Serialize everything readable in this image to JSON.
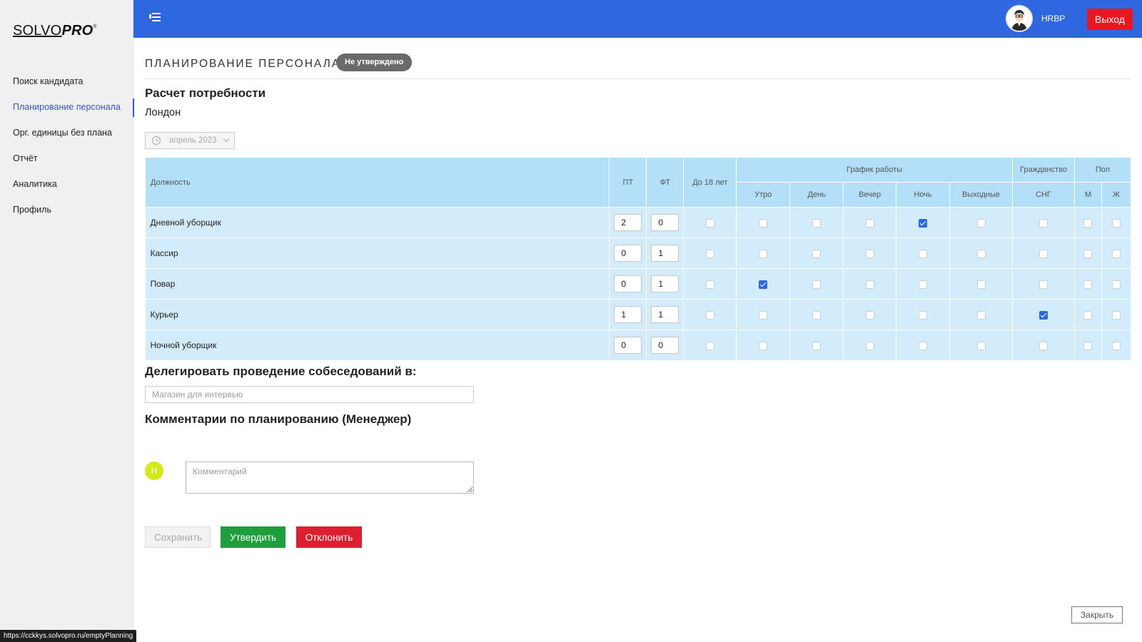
{
  "brand": {
    "solvo": "SOLVO",
    "pro": "PRO",
    "mark": "®"
  },
  "sidebar": {
    "items": [
      {
        "label": "Поиск кандидата",
        "active": false
      },
      {
        "label": "Планирование персонала",
        "active": true
      },
      {
        "label": "Орг. единицы без плана",
        "active": false
      },
      {
        "label": "Отчёт",
        "active": false
      },
      {
        "label": "Аналитика",
        "active": false
      },
      {
        "label": "Профиль",
        "active": false
      }
    ]
  },
  "topbar": {
    "user": "HRBP",
    "logout": "Выход"
  },
  "page": {
    "title": "ПЛАНИРОВАНИЕ ПЕРСОНАЛА",
    "status": "Не утверждено"
  },
  "calc": {
    "title": "Расчет потребности",
    "city": "Лондон",
    "date": "апрель 2023"
  },
  "table": {
    "headers": {
      "position": "Должность",
      "pt": "ПТ",
      "ft": "ФТ",
      "under18": "До 18 лет",
      "schedule": "График работы",
      "citizenship": "Гражданство",
      "gender": "Пол",
      "morning": "Утро",
      "day": "День",
      "evening": "Вечер",
      "night": "Ночь",
      "weekend": "Выходные",
      "cis": "СНГ",
      "male": "М",
      "female": "Ж"
    },
    "rows": [
      {
        "position": "Дневной уборщик",
        "pt": "2",
        "ft": "0",
        "checks": [
          false,
          false,
          false,
          false,
          true,
          false,
          false,
          false,
          false
        ]
      },
      {
        "position": "Кассир",
        "pt": "0",
        "ft": "1",
        "checks": [
          false,
          false,
          false,
          false,
          false,
          false,
          false,
          false,
          false
        ]
      },
      {
        "position": "Повар",
        "pt": "0",
        "ft": "1",
        "checks": [
          false,
          true,
          false,
          false,
          false,
          false,
          false,
          false,
          false
        ]
      },
      {
        "position": "Курьер",
        "pt": "1",
        "ft": "1",
        "checks": [
          false,
          false,
          false,
          false,
          false,
          false,
          true,
          false,
          false
        ]
      },
      {
        "position": "Ночной уборщик",
        "pt": "0",
        "ft": "0",
        "checks": [
          false,
          false,
          false,
          false,
          false,
          false,
          false,
          false,
          false
        ]
      }
    ]
  },
  "delegate": {
    "title": "Делегировать проведение собеседований в:",
    "placeholder": "Магазин для интервью"
  },
  "comments": {
    "title": "Комментарии по планированию (Менеджер)",
    "avatar_letter": "H",
    "placeholder": "Комментарий"
  },
  "buttons": {
    "save": "Сохранить",
    "approve": "Утвердить",
    "reject": "Отклонить",
    "close": "Закрыть"
  },
  "status_bar": {
    "url": "https://cckkys.solvopro.ru/emptyPlanning"
  },
  "colors": {
    "accent": "#2f67e0",
    "logout": "#e8161e",
    "approve": "#1f9e3d",
    "reject": "#dc1f30",
    "table_header": "#b3dff9",
    "table_row": "#d3ecfb"
  },
  "icons": {
    "menu": "menu-collapse-icon",
    "date": "clock-icon",
    "chevron": "chevron-down-icon",
    "checkbox_on": "checkbox-checked-icon"
  }
}
